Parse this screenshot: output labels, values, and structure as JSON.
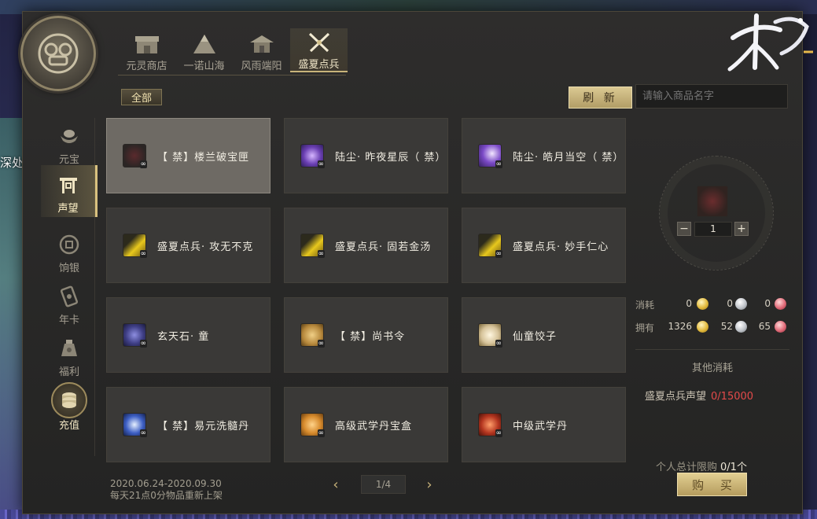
{
  "tabs": [
    {
      "label": "元灵商店",
      "icon": "shop-icon"
    },
    {
      "label": "一诺山海",
      "icon": "mountain-icon"
    },
    {
      "label": "风雨端阳",
      "icon": "pavilion-icon"
    },
    {
      "label": "盛夏点兵",
      "icon": "crossed-swords-icon"
    }
  ],
  "active_tab": 3,
  "filter_all": "全部",
  "refresh_label": "刷 新",
  "search_placeholder": "请输入商品名字",
  "sidebar": [
    {
      "label": "元宝",
      "icon": "ingot-icon"
    },
    {
      "label": "声望",
      "icon": "gate-icon"
    },
    {
      "label": "饷银",
      "icon": "coin-icon"
    },
    {
      "label": "年卡",
      "icon": "card-icon"
    },
    {
      "label": "福利",
      "icon": "gift-bag-icon"
    },
    {
      "label": "充值",
      "icon": "coin-stack-icon"
    }
  ],
  "active_sidebar": 1,
  "items": [
    {
      "name": "【 禁】楼兰破宝匣",
      "icon": "armor-icon",
      "color": "#5a2a2d"
    },
    {
      "name": "陆尘· 昨夜星辰（ 禁）",
      "icon": "purple-fx-icon",
      "color": "#6a3fb2"
    },
    {
      "name": "陆尘· 皓月当空（ 禁）",
      "icon": "purple-moon-icon",
      "color": "#7b4ac7"
    },
    {
      "name": "盛夏点兵· 攻无不克",
      "icon": "gold-shard-icon",
      "color": "#b99a1d"
    },
    {
      "name": "盛夏点兵· 固若金汤",
      "icon": "gold-shard-icon",
      "color": "#b99a1d"
    },
    {
      "name": "盛夏点兵· 妙手仁心",
      "icon": "gold-shard-icon",
      "color": "#b99a1d"
    },
    {
      "name": "玄天石· 童",
      "icon": "dark-stone-icon",
      "color": "#3f3f86"
    },
    {
      "name": "【 禁】尚书令",
      "icon": "scroll-bag-icon",
      "color": "#b5873b"
    },
    {
      "name": "仙童饺子",
      "icon": "dumpling-icon",
      "color": "#d6c39a"
    },
    {
      "name": "【 禁】易元洗髓丹",
      "icon": "blue-pill-icon",
      "color": "#3d5fc4"
    },
    {
      "name": "高级武学丹宝盒",
      "icon": "orange-pill-box-icon",
      "color": "#d68a2c"
    },
    {
      "name": "中级武学丹",
      "icon": "red-pill-icon",
      "color": "#b3351f"
    }
  ],
  "selected_item": 0,
  "detail": {
    "quantity": "1",
    "minus": "−",
    "plus": "+",
    "cost_label": "消耗",
    "cost_gold": "0",
    "cost_silver": "0",
    "cost_red": "0",
    "own_label": "拥有",
    "own_gold": "1326",
    "own_silver": "52",
    "own_red": "65",
    "other_title": "其他消耗",
    "other_req_label": "盛夏点兵声望",
    "other_req_value": "0/15000"
  },
  "limit_label": "个人总计限购",
  "limit_value": "0/1个",
  "buy_label": "购 买",
  "date_line1": "2020.06.24-2020.09.30",
  "date_line2": "每天21点0分物品重新上架",
  "pager": {
    "text": "1/4",
    "prev": "‹",
    "next": "›"
  },
  "background_text": "深处",
  "colors": {
    "accent": "#d9c17f",
    "warning": "#e44a4a",
    "button": "#dbc992"
  }
}
